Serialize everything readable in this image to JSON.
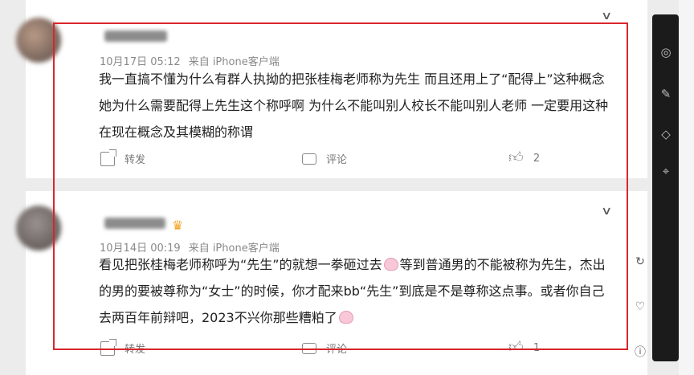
{
  "comments": [
    {
      "meta": "10月17日 05:12",
      "source": "来自 iPhone客户端",
      "text": "我一直搞不懂为什么有群人执拗的把张桂梅老师称为先生 而且还用上了“配得上”这种概念 她为什么需要配得上先生这个称呼啊 为什么不能叫别人校长不能叫别人老师 一定要用这种在现在概念及其模糊的称谓",
      "share_label": "转发",
      "comment_label": "评论",
      "like_count": "2"
    },
    {
      "meta": "10月14日 00:19",
      "source": "来自 iPhone客户端",
      "text_part1": "看见把张桂梅老师称呼为“先生”的就想一拳砸过去",
      "text_part2": "等到普通男的不能被称为先生，杰出的男的要被尊称为“女士”的时候，你才配来bb“先生”到底是不是尊称这点事。或者你自己去两百年前辩吧，2023不兴你那些糟粕了",
      "share_label": "转发",
      "comment_label": "评论",
      "like_count": "1"
    }
  ],
  "icons": {
    "chevron": "chevron-down-icon",
    "share": "share-icon",
    "comment": "comment-icon",
    "like": "thumbs-up-icon",
    "vip": "crown-icon",
    "emoji": "bunny-emoji-icon"
  },
  "colors": {
    "highlight": "#d9262b",
    "meta": "#8a8a8a",
    "text": "#222222",
    "sidebar": "#1b1b1b"
  }
}
